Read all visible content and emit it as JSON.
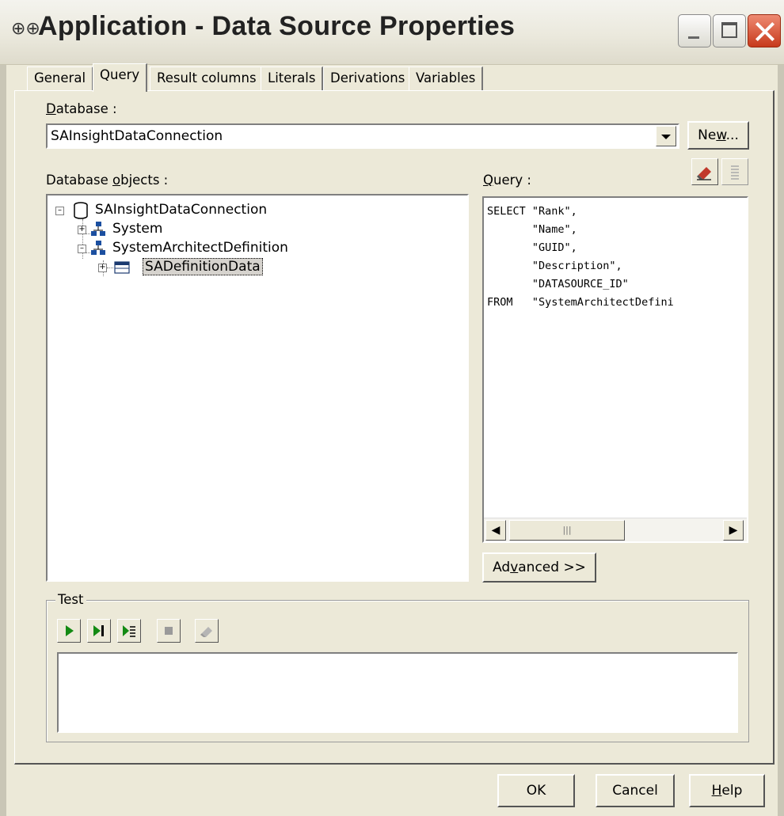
{
  "window": {
    "title": "Application - Data Source Properties",
    "app_icon": "sa-app-icon"
  },
  "tabs": [
    {
      "label": "General",
      "active": false
    },
    {
      "label": "Query",
      "active": true
    },
    {
      "label": "Result columns",
      "active": false
    },
    {
      "label": "Literals",
      "active": false
    },
    {
      "label": "Derivations",
      "active": false
    },
    {
      "label": "Variables",
      "active": false
    }
  ],
  "database": {
    "label_mnemonic": "D",
    "label_rest": "atabase :",
    "value": "SAInsightDataConnection",
    "new_button_pre": "Ne",
    "new_button_mnemonic": "w",
    "new_button_post": "..."
  },
  "objects": {
    "label_pre": "Database ",
    "label_mnemonic": "o",
    "label_post": "bjects :",
    "tree": [
      {
        "label": "SAInsightDataConnection",
        "icon": "database-icon",
        "expanded": true,
        "level": 0
      },
      {
        "label": "System",
        "icon": "schema-icon",
        "expanded": false,
        "level": 1
      },
      {
        "label": "SystemArchitectDefinition",
        "icon": "schema-icon",
        "expanded": true,
        "level": 1
      },
      {
        "label": "SADefinitionData",
        "icon": "table-icon",
        "expanded": false,
        "level": 2,
        "selected": true
      }
    ]
  },
  "query": {
    "label_mnemonic": "Q",
    "label_rest": "uery :",
    "text": "SELECT \"Rank\",\n       \"Name\",\n       \"GUID\",\n       \"Description\",\n       \"DATASOURCE_ID\"\nFROM   \"SystemArchitectDefini",
    "advanced_pre": "Ad",
    "advanced_mnemonic": "v",
    "advanced_post": "anced >>"
  },
  "test": {
    "legend": "Test",
    "toolbar": [
      "run-icon",
      "run-single-icon",
      "run-step-icon",
      "stop-icon",
      "clear-icon"
    ],
    "output": ""
  },
  "footer": {
    "ok": "OK",
    "cancel": "Cancel",
    "help_mnemonic": "H",
    "help_rest": "elp"
  },
  "colors": {
    "window_bg": "#ece9d8",
    "selection_bg": "#d6d3ce",
    "close_button": "#d4502f",
    "run_green": "#138a13"
  }
}
